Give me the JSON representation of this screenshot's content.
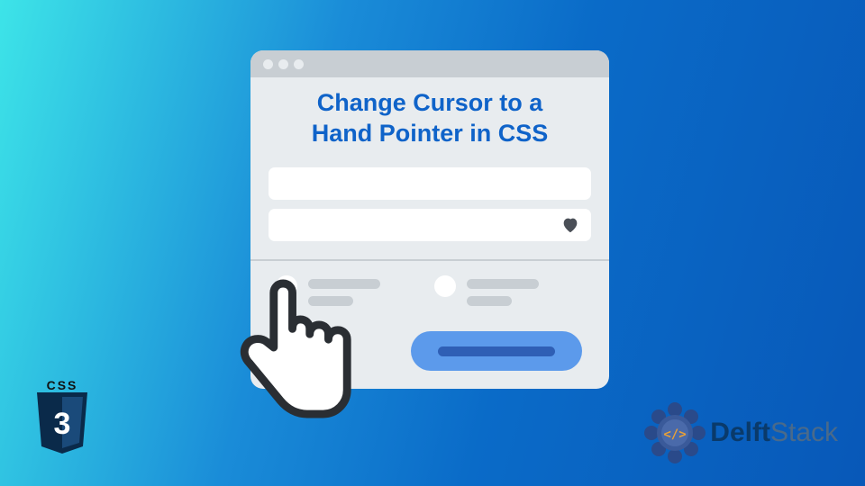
{
  "title": {
    "line1": "Change Cursor to a",
    "line2": "Hand Pointer in CSS"
  },
  "badges": {
    "css_label": "CSS",
    "css_number": "3"
  },
  "brand": {
    "name_part1": "Delft",
    "name_part2": "Stack"
  },
  "icons": {
    "heart": "heart-icon",
    "hand": "hand-pointer-icon",
    "css_shield": "css3-shield-icon",
    "delft_gear": "delft-gear-icon"
  },
  "colors": {
    "title": "#0f63c9",
    "button": "#5c9aeb",
    "button_inner": "#2f5fb5",
    "heart": "#4a4f57"
  }
}
